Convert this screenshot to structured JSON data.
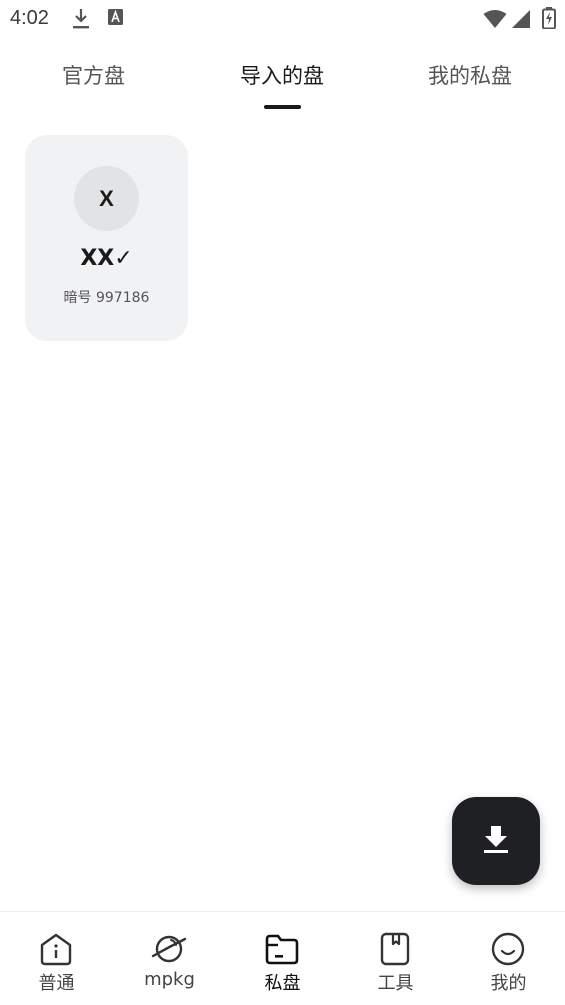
{
  "status_bar": {
    "time": "4:02",
    "icons": [
      "download-icon",
      "a-square-icon",
      "wifi-icon",
      "signal-icon",
      "battery-charging-icon"
    ]
  },
  "tabs": [
    {
      "label": "官方盘",
      "active": false
    },
    {
      "label": "导入的盘",
      "active": true
    },
    {
      "label": "我的私盘",
      "active": false
    }
  ],
  "cards": [
    {
      "avatar_letter": "X",
      "title": "XX✓",
      "code": "暗号 997186"
    }
  ],
  "fab": {
    "icon": "download-icon"
  },
  "bottom_nav": [
    {
      "label": "普通",
      "icon": "info-house-icon",
      "active": false
    },
    {
      "label": "mpkg",
      "icon": "planet-icon",
      "active": false
    },
    {
      "label": "私盘",
      "icon": "folder-icon",
      "active": true
    },
    {
      "label": "工具",
      "icon": "bookmark-book-icon",
      "active": false
    },
    {
      "label": "我的",
      "icon": "smile-icon",
      "active": false
    }
  ],
  "colors": {
    "card_bg": "#f1f2f4",
    "fab_bg": "#1f2023",
    "active_text": "#1a1a1a",
    "inactive_text": "#555555"
  }
}
